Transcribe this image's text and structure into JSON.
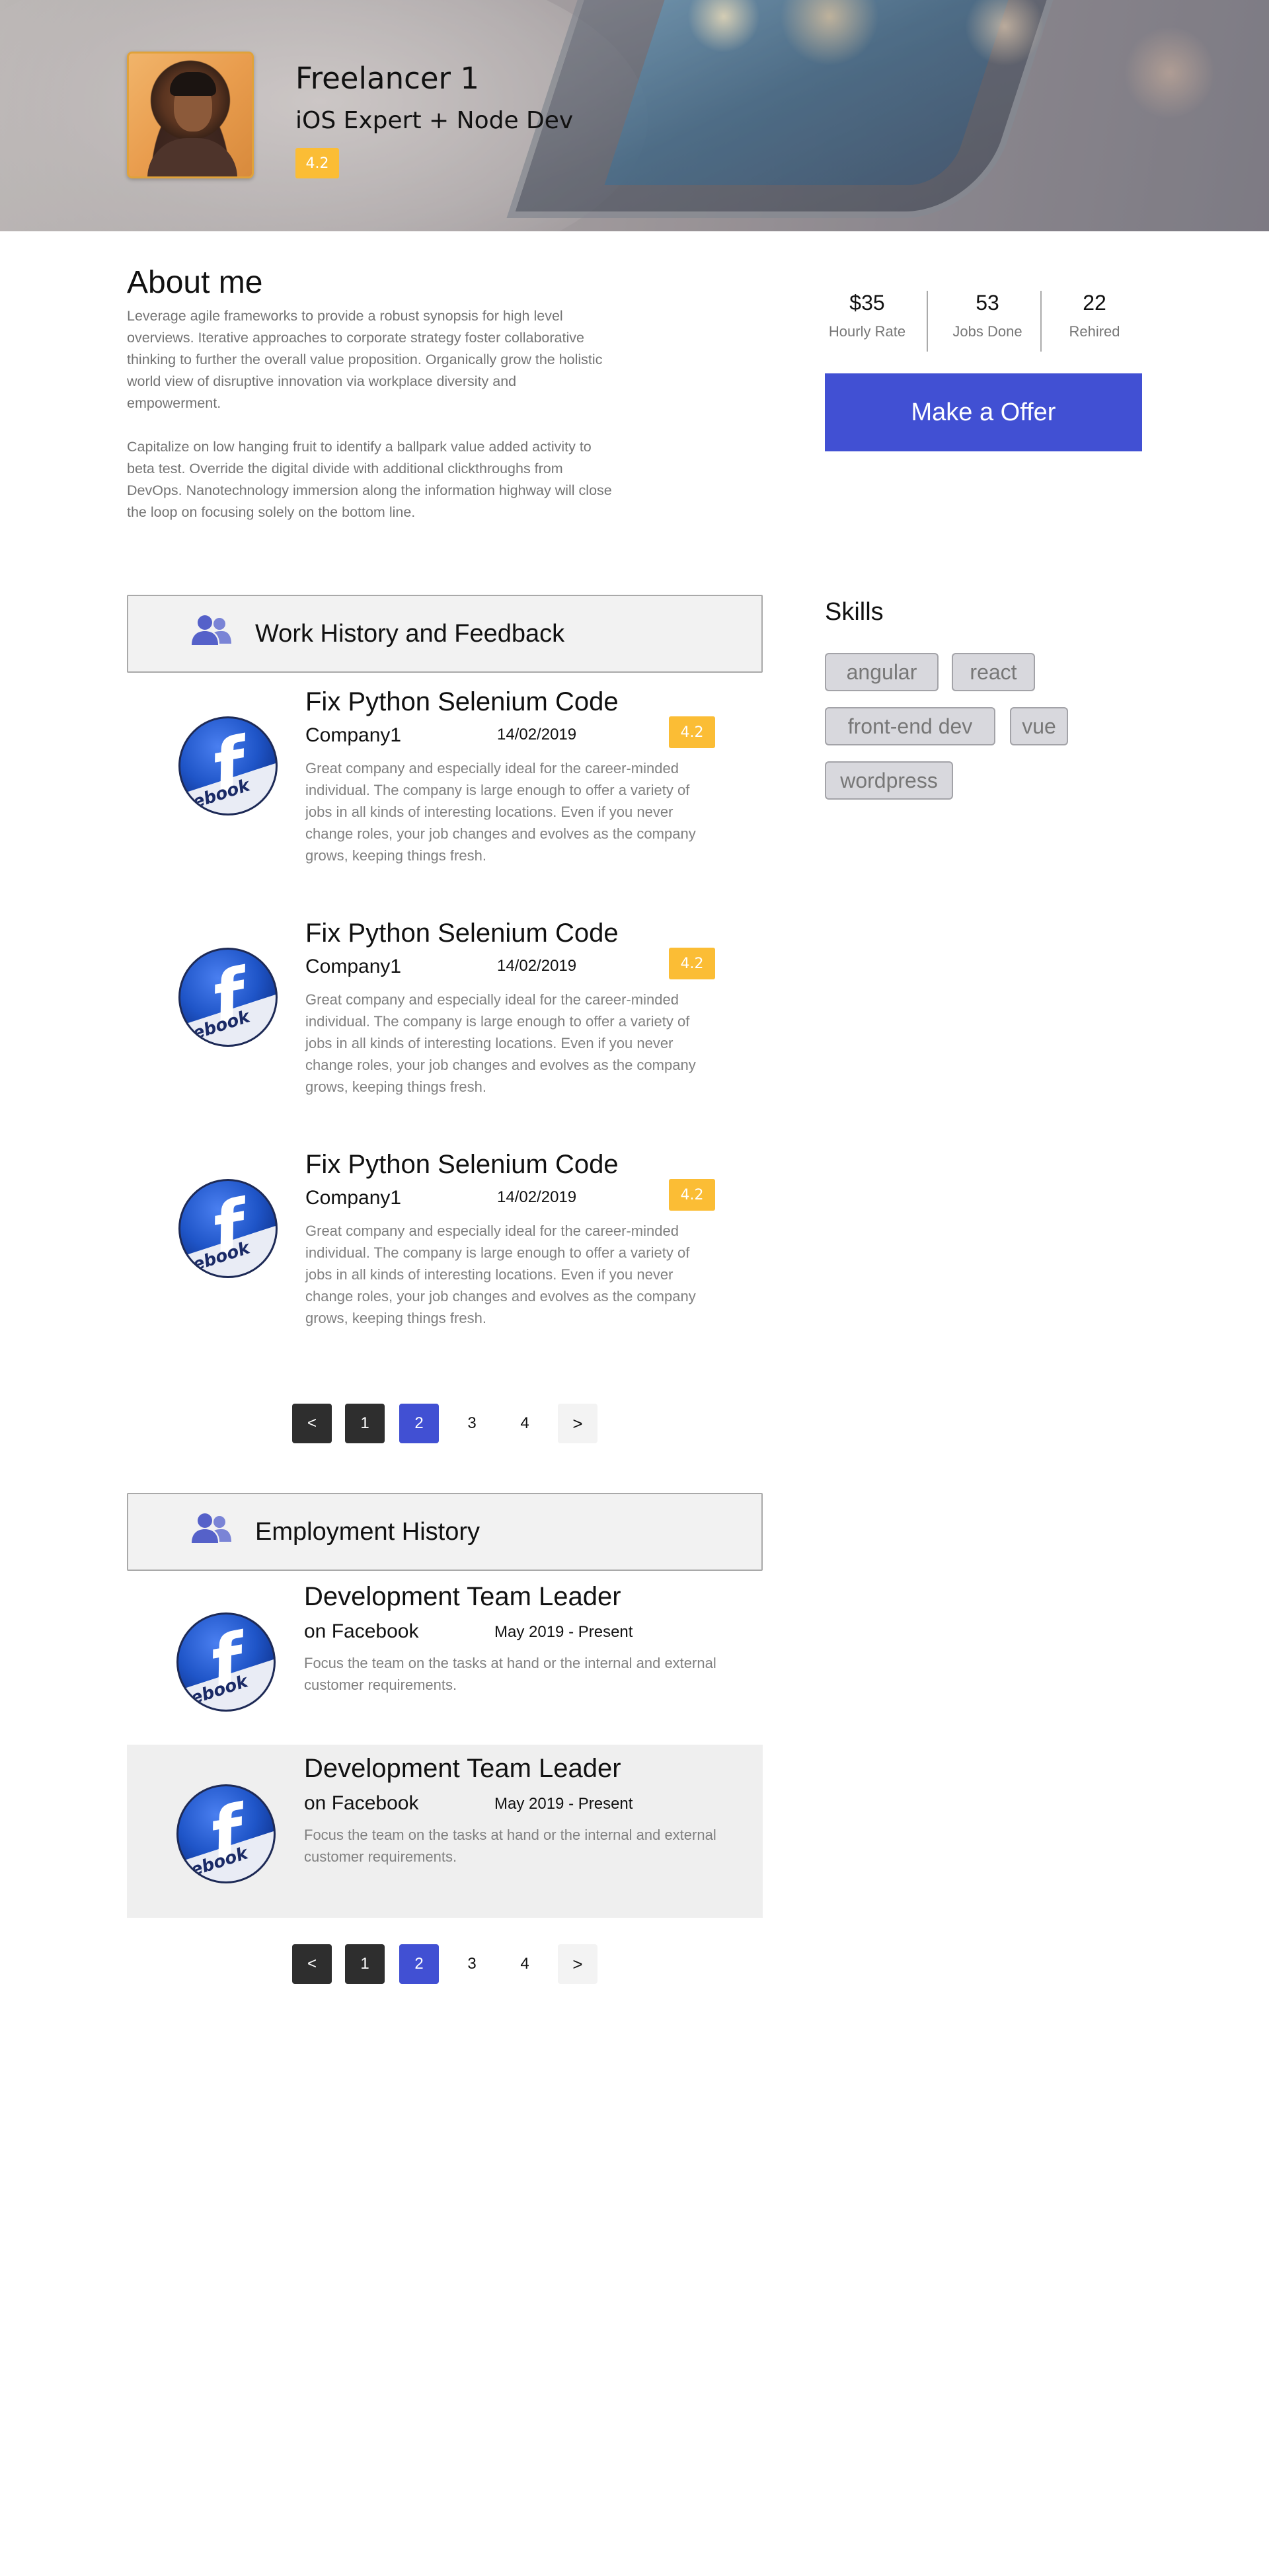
{
  "profile": {
    "name": "Freelancer 1",
    "title": "iOS Expert + Node Dev",
    "rating": "4.2"
  },
  "about": {
    "heading": "About me",
    "paragraphs": [
      "Leverage agile frameworks to provide a robust synopsis for high level overviews. Iterative approaches to corporate strategy foster collaborative thinking to further the overall value proposition. Organically grow the holistic world view of disruptive innovation via workplace diversity and empowerment.",
      "Capitalize on low hanging fruit to identify a ballpark value added activity to beta test. Override the digital divide with additional clickthroughs from DevOps. Nanotechnology immersion along the information highway will close the loop on focusing solely on the bottom line."
    ]
  },
  "stats": [
    {
      "value": "$35",
      "label": "Hourly Rate"
    },
    {
      "value": "53",
      "label": "Jobs Done"
    },
    {
      "value": "22",
      "label": "Rehired"
    }
  ],
  "offer_button": "Make a Offer",
  "skills": {
    "heading": "Skills",
    "tags": [
      "angular",
      "react",
      "front-end dev",
      "vue",
      "wordpress"
    ]
  },
  "work_history": {
    "heading": "Work History and Feedback",
    "items": [
      {
        "job": "Fix Python Selenium Code",
        "company": "Company1",
        "date": "14/02/2019",
        "rating": "4.2",
        "text": "Great company and especially ideal for the career-minded individual. The company is large enough to offer a variety of jobs in all kinds of interesting locations. Even if you never change roles, your job changes and evolves as the company grows, keeping things fresh.",
        "logo_text": "cebook"
      },
      {
        "job": "Fix Python Selenium Code",
        "company": "Company1",
        "date": "14/02/2019",
        "rating": "4.2",
        "text": "Great company and especially ideal for the career-minded individual. The company is large enough to offer a variety of jobs in all kinds of interesting locations. Even if you never change roles, your job changes and evolves as the company grows, keeping things fresh.",
        "logo_text": "cebook"
      },
      {
        "job": "Fix Python Selenium Code",
        "company": "Company1",
        "date": "14/02/2019",
        "rating": "4.2",
        "text": "Great company and especially ideal for the career-minded individual. The company is large enough to offer a variety of jobs in all kinds of interesting locations. Even if you never change roles, your job changes and evolves as the company grows, keeping things fresh.",
        "logo_text": "cebook"
      }
    ],
    "pagination": {
      "prev": "<",
      "pages": [
        "1",
        "2",
        "3",
        "4"
      ],
      "next": ">",
      "current": "2"
    }
  },
  "employment": {
    "heading": "Employment History",
    "items": [
      {
        "role": "Development Team Leader",
        "org": "on Facebook",
        "period": "May 2019 - Present",
        "text": "Focus the team on the tasks at hand or the internal and external customer requirements.",
        "logo_text": "cebook"
      },
      {
        "role": "Development Team Leader",
        "org": "on Facebook",
        "period": "May 2019 - Present",
        "text": "Focus the team on the tasks at hand or the internal and external customer requirements.",
        "logo_text": "cebook"
      }
    ],
    "pagination": {
      "prev": "<",
      "pages": [
        "1",
        "2",
        "3",
        "4"
      ],
      "next": ">",
      "current": "2"
    }
  },
  "colors": {
    "accent": "#4150d3",
    "rating": "#fbbd35",
    "dark_button": "#2e2e2e",
    "section_icon": "#5561c9"
  },
  "icons": {
    "section": "users-icon",
    "logo": "facebook-logo"
  }
}
